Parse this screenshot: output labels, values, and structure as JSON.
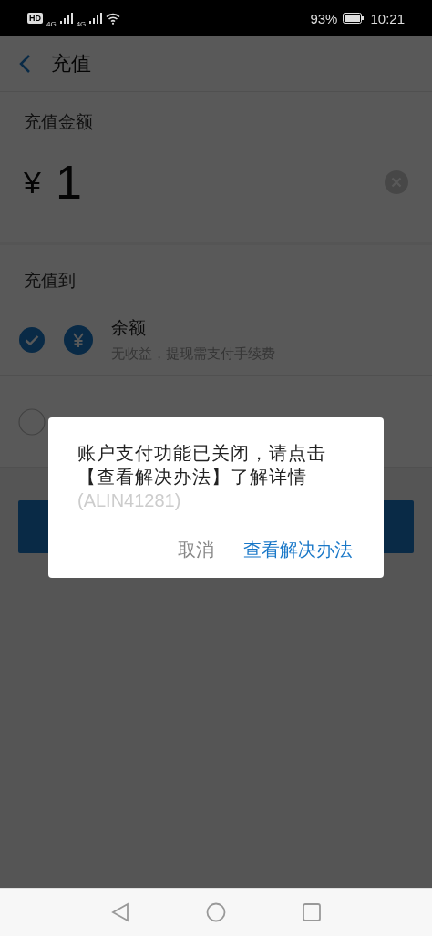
{
  "status_bar": {
    "badges": [
      "HD",
      "4G",
      "4G"
    ],
    "battery": "93%",
    "time": "10:21"
  },
  "header": {
    "title": "充值"
  },
  "amount_section": {
    "label": "充值金额",
    "currency": "¥",
    "value": "1"
  },
  "target_section": {
    "label": "充值到",
    "options": [
      {
        "title": "余额",
        "subtitle": "无收益，提现需支付手续费",
        "selected": true
      },
      {
        "selected": false
      }
    ]
  },
  "dialog": {
    "message": "账户支付功能已关闭，请点击【查看解决办法】了解详情",
    "code": "(ALIN41281)",
    "buttons": [
      {
        "label": "取消",
        "kind": "cancel"
      },
      {
        "label": "查看解决办法",
        "kind": "primary"
      }
    ]
  }
}
